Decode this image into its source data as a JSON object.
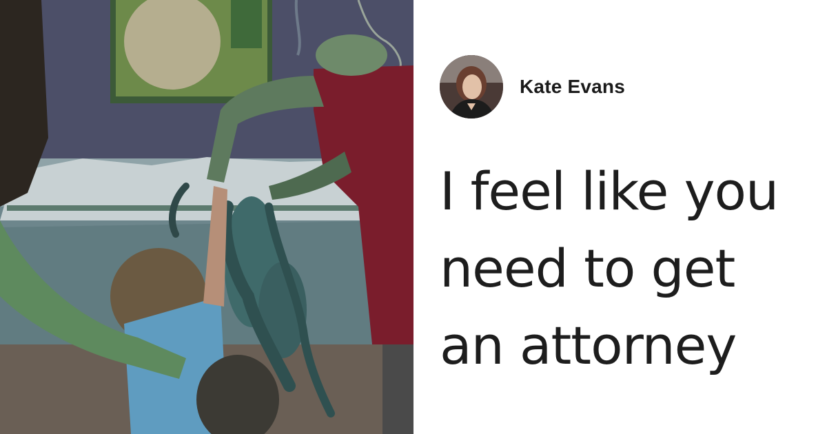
{
  "author": {
    "name": "Kate Evans",
    "avatar_icon": "profile-photo"
  },
  "quote": {
    "lines": [
      "I feel like you",
      "need to get",
      "an attorney"
    ]
  },
  "photo": {
    "description_icon": "aquarium-octopus-photo"
  },
  "colors": {
    "background": "#ffffff",
    "text": "#1d1d1d",
    "shirt": "#7a1d2c",
    "tank": "#8fa3a8"
  }
}
